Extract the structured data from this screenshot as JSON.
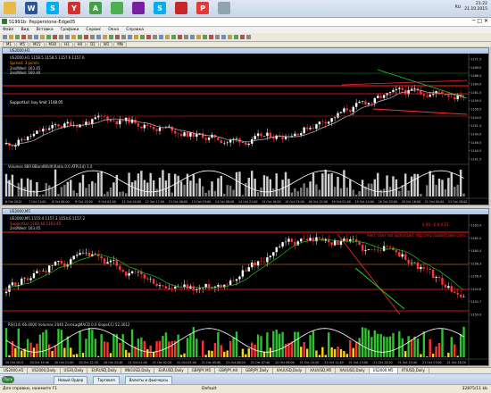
{
  "os_taskbar": {
    "time": "21:22",
    "date": "21.10.2015",
    "lang": "RU",
    "apps": [
      "folder-icon",
      "word-icon",
      "skype-icon",
      "yandex-icon",
      "android-icon",
      "chrome-icon",
      "winrar-icon",
      "skype-icon",
      "pdf-icon",
      "opera-icon",
      "doc-icon"
    ],
    "app_letters": [
      "",
      "W",
      "S",
      "Y",
      "A",
      "",
      "",
      "S",
      "",
      "P",
      ""
    ],
    "app_colors": [
      "#e8b84a",
      "#2b5797",
      "#00aff0",
      "#d32f2f",
      "#43a047",
      "#4caf50",
      "#7b1fa2",
      "#00aff0",
      "#c62828",
      "#e53935",
      "#90a4ae"
    ]
  },
  "window": {
    "title": "51991b: Pepperstone-Edge05",
    "menu": [
      "Файл",
      "Вид",
      "Вставка",
      "Графики",
      "Сервис",
      "Окно",
      "Справка"
    ],
    "timeframes": [
      "M1",
      "M5",
      "M15",
      "M30",
      "H1",
      "H4",
      "D1",
      "W1",
      "MN"
    ]
  },
  "chart1": {
    "window_title": "US2000,H1",
    "symbol_line": "US2000,H1  1158.5 1158.5 1157.6 1157.6",
    "spread_line": "Spread: 3 points",
    "indicator_label": "Volumes 889  BBandWidthRatio 0.0  ATR(14) 1.0",
    "price_levels": [
      "1171.5",
      "1169.0",
      "1166.5",
      "1164.0",
      "1161.5",
      "1159.0",
      "1156.5",
      "1154.0",
      "1151.5",
      "1149.0",
      "1146.5",
      "1144.0",
      "1141.5"
    ],
    "current_price": "1157.6",
    "time_labels": [
      "6 Oct 2015",
      "7 Oct 11:00",
      "8 Oct 00:00",
      "8 Oct 13:00",
      "9 Oct 02:00",
      "12 Oct 04:00",
      "12 Oct 17:00",
      "13 Oct 06:00",
      "13 Oct 19:00",
      "14 Oct 08:00",
      "14 Oct 21:00",
      "15 Oct 10:00",
      "15 Oct 23:00",
      "16 Oct 12:00",
      "19 Oct 01:00",
      "19 Oct 14:00",
      "20 Oct 03:00",
      "20 Oct 16:00",
      "21 Oct 05:00",
      "21 Oct 18:00"
    ],
    "overlay_texts": [
      "2nd/Wed: 163.45",
      "2nd/Wed: 160.40",
      "SupportLvl: buy limit 1148.05"
    ]
  },
  "chart2": {
    "window_title": "US2000,M5",
    "symbol_line": "US2000,M5  1155.4 1157.3 1154.6 1157.2",
    "alert": "Alert: User not authorized: http://my.clustertrader.com/...",
    "top_right_vals": "0.00 - 0.0 0.15",
    "indicator_label": "RSI(14) 66.0000  Volumes 2040  ZeroLagMACD 0.0 SlopeCCI 52.3012",
    "price_levels": [
      "1163.9",
      "1162.0",
      "1160.4",
      "1158.3",
      "1156.4",
      "1154.6",
      "1152.7",
      "1150.9"
    ],
    "rsi_levels": [
      "100",
      "70",
      "30",
      "0"
    ],
    "current_price": "1157.2",
    "time_labels": [
      "20 Oct 2015",
      "20 Oct 19:40",
      "20 Oct 21:00",
      "20 Oct 22:20",
      "20 Oct 23:40",
      "21 Oct 01:00",
      "21 Oct 02:20",
      "21 Oct 03:40",
      "21 Oct 05:00",
      "21 Oct 06:20",
      "21 Oct 07:40",
      "21 Oct 09:00",
      "21 Oct 10:20",
      "21 Oct 11:40",
      "21 Oct 13:00",
      "21 Oct 14:20",
      "21 Oct 15:40",
      "21 Oct 17:00",
      "21 Oct 18:20"
    ],
    "overlay_texts": [
      "SupportLvl 1160.40 1163.45",
      "2nd/Wed: 163.45"
    ]
  },
  "tabs": [
    "US2000,H1",
    "US2000,Daily",
    "US30,Daily",
    "EURUSD,Daily",
    "XNGUSD,Daily",
    "EURUSD,Daily",
    "GBPJPY,M5",
    "GBPJPY,H4",
    "GBPJPY,Daily",
    "XAUUSD,Daily",
    "XAUUSD,M5",
    "XAUUSD,Daily",
    "US2000,M5",
    "XTIUSD,Daily"
  ],
  "active_tab": "US2000,M5",
  "win_taskbar": {
    "start": "Пуск",
    "items": [
      "Новый Ордер",
      "Торговля",
      "Валюты и фьючерсы"
    ],
    "wm_title": "Валюты и фьючерсы"
  },
  "status": {
    "help": "Для справки, нажмите F1",
    "profile": "Default",
    "traffic": "32875/11 kb"
  }
}
